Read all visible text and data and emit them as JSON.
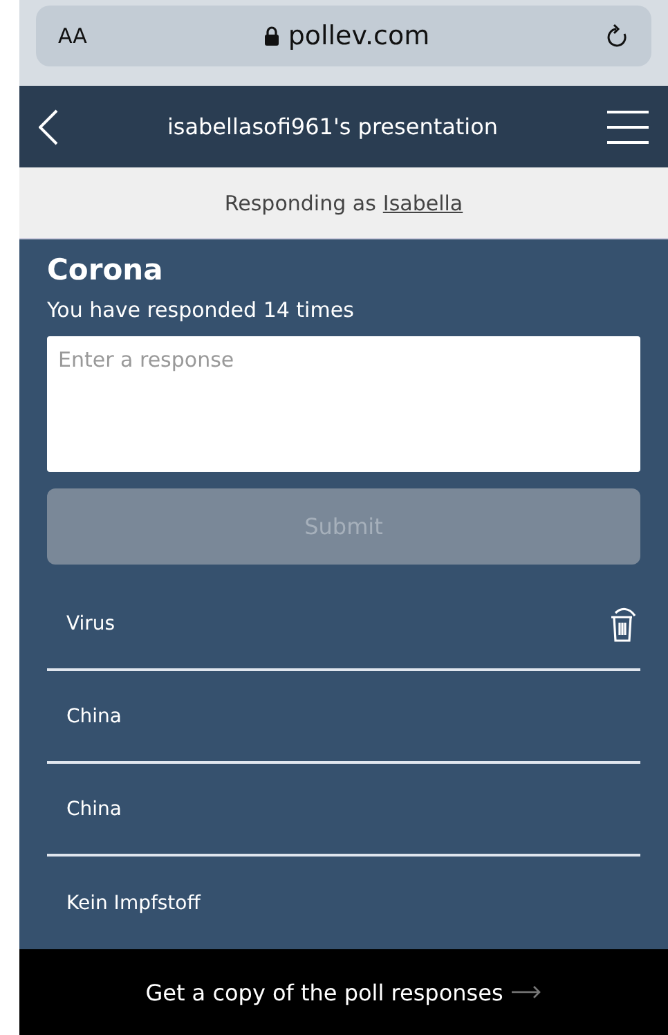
{
  "browser": {
    "text_size": "AA",
    "address": "pollev.com"
  },
  "header": {
    "title": "isabellasofi961's presentation"
  },
  "responder": {
    "prefix": "Responding as",
    "name": "Isabella"
  },
  "poll": {
    "title": "Corona",
    "count_text": "You have responded 14 times",
    "input": {
      "placeholder": "Enter a response"
    },
    "submit": {
      "label": "Submit",
      "disabled": true
    }
  },
  "responses": [
    {
      "text": "Virus",
      "deletable": true
    },
    {
      "text": "China",
      "deletable": false
    },
    {
      "text": "China",
      "deletable": false
    },
    {
      "text": "Kein Impfstoff",
      "deletable": false
    }
  ],
  "footer": {
    "link": "Get a copy of the poll responses"
  }
}
